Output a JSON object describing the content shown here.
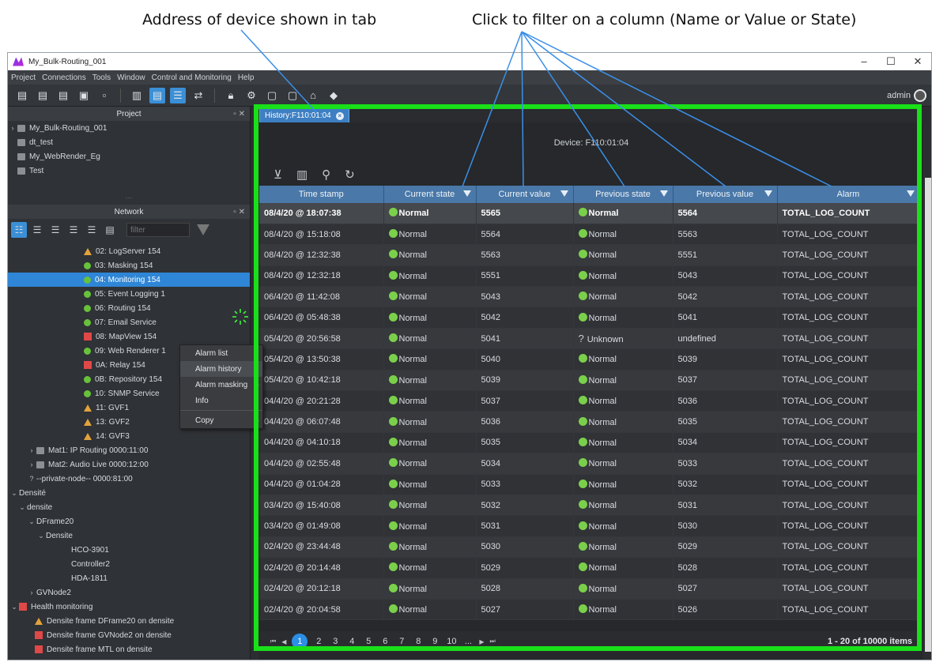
{
  "callouts": {
    "tab_address": "Address of device shown in tab",
    "filter_columns": "Click to filter on a column (Name or Value or State)"
  },
  "window": {
    "title": "My_Bulk-Routing_001",
    "minimize": "–",
    "maximize": "☐",
    "close": "✕"
  },
  "menu": [
    "Project",
    "Connections",
    "Tools",
    "Window",
    "Control and Monitoring",
    "Help"
  ],
  "user": "admin",
  "project_panel": {
    "title": "Project",
    "items": [
      "My_Bulk-Routing_001",
      "dt_test",
      "My_WebRender_Eg",
      "Test"
    ]
  },
  "network_panel": {
    "title": "Network",
    "filter_placeholder": "filter",
    "items": [
      {
        "label": "02: LogServer 154",
        "status": "warning"
      },
      {
        "label": "03: Masking 154",
        "status": "ok"
      },
      {
        "label": "04: Monitoring 154",
        "status": "ok",
        "selected": true
      },
      {
        "label": "05: Event Logging 1",
        "status": "ok"
      },
      {
        "label": "06: Routing 154",
        "status": "ok"
      },
      {
        "label": "07: Email Service",
        "status": "ok"
      },
      {
        "label": "08: MapView 154",
        "status": "error"
      },
      {
        "label": "09: Web Renderer 1",
        "status": "ok"
      },
      {
        "label": "0A: Relay 154",
        "status": "error"
      },
      {
        "label": "0B: Repository 154",
        "status": "ok"
      },
      {
        "label": "10: SNMP Service",
        "status": "ok"
      },
      {
        "label": "11: GVF1",
        "status": "warning"
      },
      {
        "label": "13: GVF2",
        "status": "warning"
      },
      {
        "label": "14: GVF3",
        "status": "warning"
      },
      {
        "label": "Mat1: IP Routing 0000:11:00",
        "status": "folder"
      },
      {
        "label": "Mat2: Audio Live 0000:12:00",
        "status": "folder"
      },
      {
        "label": "--private-node-- 0000:81:00",
        "status": "unknown"
      },
      {
        "label": "Densité",
        "status": "group"
      },
      {
        "label": "densite",
        "status": "group"
      },
      {
        "label": "DFrame20",
        "status": "group"
      },
      {
        "label": "Densite",
        "status": "group"
      },
      {
        "label": "HCO-3901",
        "status": "leaf"
      },
      {
        "label": "Controller2",
        "status": "leaf"
      },
      {
        "label": "HDA-1811",
        "status": "leaf"
      },
      {
        "label": "GVNode2",
        "status": "collapsed"
      },
      {
        "label": "Health monitoring",
        "status": "health"
      },
      {
        "label": "Densite frame DFrame20 on densite",
        "status": "warning"
      },
      {
        "label": "Densite frame GVNode2 on densite",
        "status": "error"
      },
      {
        "label": "Densite frame MTL on densite",
        "status": "error"
      }
    ]
  },
  "context_menu": {
    "items": [
      "Alarm list",
      "Alarm history",
      "Alarm masking",
      "Info",
      "Copy"
    ]
  },
  "tab": {
    "label": "History:F110:01:04"
  },
  "device_label": "Device: F110:01:04",
  "grid": {
    "columns": [
      "Time stamp",
      "Current state",
      "Current value",
      "Previous state",
      "Previous value",
      "Alarm"
    ],
    "rows": [
      [
        "08/4/20 @ 18:07:38",
        "Normal",
        "5565",
        "Normal",
        "5564",
        "TOTAL_LOG_COUNT"
      ],
      [
        "08/4/20 @ 15:18:08",
        "Normal",
        "5564",
        "Normal",
        "5563",
        "TOTAL_LOG_COUNT"
      ],
      [
        "08/4/20 @ 12:32:38",
        "Normal",
        "5563",
        "Normal",
        "5551",
        "TOTAL_LOG_COUNT"
      ],
      [
        "08/4/20 @ 12:32:18",
        "Normal",
        "5551",
        "Normal",
        "5043",
        "TOTAL_LOG_COUNT"
      ],
      [
        "06/4/20 @ 11:42:08",
        "Normal",
        "5043",
        "Normal",
        "5042",
        "TOTAL_LOG_COUNT"
      ],
      [
        "06/4/20 @ 05:48:38",
        "Normal",
        "5042",
        "Normal",
        "5041",
        "TOTAL_LOG_COUNT"
      ],
      [
        "05/4/20 @ 20:56:58",
        "Normal",
        "5041",
        "Unknown",
        "undefined",
        "TOTAL_LOG_COUNT"
      ],
      [
        "05/4/20 @ 13:50:38",
        "Normal",
        "5040",
        "Normal",
        "5039",
        "TOTAL_LOG_COUNT"
      ],
      [
        "05/4/20 @ 10:42:18",
        "Normal",
        "5039",
        "Normal",
        "5037",
        "TOTAL_LOG_COUNT"
      ],
      [
        "04/4/20 @ 20:21:28",
        "Normal",
        "5037",
        "Normal",
        "5036",
        "TOTAL_LOG_COUNT"
      ],
      [
        "04/4/20 @ 06:07:48",
        "Normal",
        "5036",
        "Normal",
        "5035",
        "TOTAL_LOG_COUNT"
      ],
      [
        "04/4/20 @ 04:10:18",
        "Normal",
        "5035",
        "Normal",
        "5034",
        "TOTAL_LOG_COUNT"
      ],
      [
        "04/4/20 @ 02:55:48",
        "Normal",
        "5034",
        "Normal",
        "5033",
        "TOTAL_LOG_COUNT"
      ],
      [
        "04/4/20 @ 01:04:28",
        "Normal",
        "5033",
        "Normal",
        "5032",
        "TOTAL_LOG_COUNT"
      ],
      [
        "03/4/20 @ 15:40:08",
        "Normal",
        "5032",
        "Normal",
        "5031",
        "TOTAL_LOG_COUNT"
      ],
      [
        "03/4/20 @ 01:49:08",
        "Normal",
        "5031",
        "Normal",
        "5030",
        "TOTAL_LOG_COUNT"
      ],
      [
        "02/4/20 @ 23:44:48",
        "Normal",
        "5030",
        "Normal",
        "5029",
        "TOTAL_LOG_COUNT"
      ],
      [
        "02/4/20 @ 20:14:48",
        "Normal",
        "5029",
        "Normal",
        "5028",
        "TOTAL_LOG_COUNT"
      ],
      [
        "02/4/20 @ 20:12:18",
        "Normal",
        "5028",
        "Normal",
        "5027",
        "TOTAL_LOG_COUNT"
      ],
      [
        "02/4/20 @ 20:04:58",
        "Normal",
        "5027",
        "Normal",
        "5026",
        "TOTAL_LOG_COUNT"
      ]
    ]
  },
  "pager": {
    "pages": [
      "1",
      "2",
      "3",
      "4",
      "5",
      "6",
      "7",
      "8",
      "9",
      "10",
      "..."
    ],
    "current": "1",
    "info": "1 - 20 of 10000 items"
  },
  "colors": {
    "highlight_frame": "#19e019",
    "callout_line": "#3b8fe8",
    "normal_state": "#7ad04a",
    "selection": "#2f86d6"
  }
}
